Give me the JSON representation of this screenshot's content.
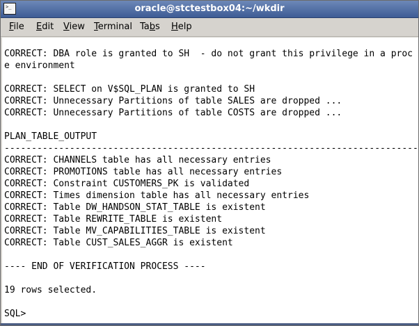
{
  "window": {
    "title": "oracle@stctestbox04:~/wkdir",
    "icon_glyph": ">_"
  },
  "menu": {
    "items": [
      {
        "accel": "F",
        "rest": "ile"
      },
      {
        "accel": "E",
        "rest": "dit"
      },
      {
        "accel": "V",
        "rest": "iew"
      },
      {
        "accel": "T",
        "rest": "erminal"
      },
      {
        "pre": "Ta",
        "accel": "b",
        "rest": "s"
      },
      {
        "accel": "H",
        "rest": "elp"
      }
    ]
  },
  "terminal": {
    "lines": [
      "CORRECT: DBA role is granted to SH  - do not grant this privilege in a proc",
      "e environment",
      "",
      "CORRECT: SELECT on V$SQL_PLAN is granted to SH",
      "CORRECT: Unnecessary Partitions of table SALES are dropped ...",
      "CORRECT: Unnecessary Partitions of table COSTS are dropped ...",
      "",
      "PLAN_TABLE_OUTPUT",
      "--------------------------------------------------------------------------------",
      "CORRECT: CHANNELS table has all necessary entries",
      "CORRECT: PROMOTIONS table has all necessary entries",
      "CORRECT: Constraint CUSTOMERS_PK is validated",
      "CORRECT: Times dimension table has all necessary entries",
      "CORRECT: Table DW_HANDSON_STAT_TABLE is existent",
      "CORRECT: Table REWRITE_TABLE is existent",
      "CORRECT: Table MV_CAPABILITIES_TABLE is existent",
      "CORRECT: Table CUST_SALES_AGGR is existent",
      "",
      "---- END OF VERIFICATION PROCESS ----",
      "",
      "19 rows selected.",
      "",
      "SQL>"
    ]
  }
}
